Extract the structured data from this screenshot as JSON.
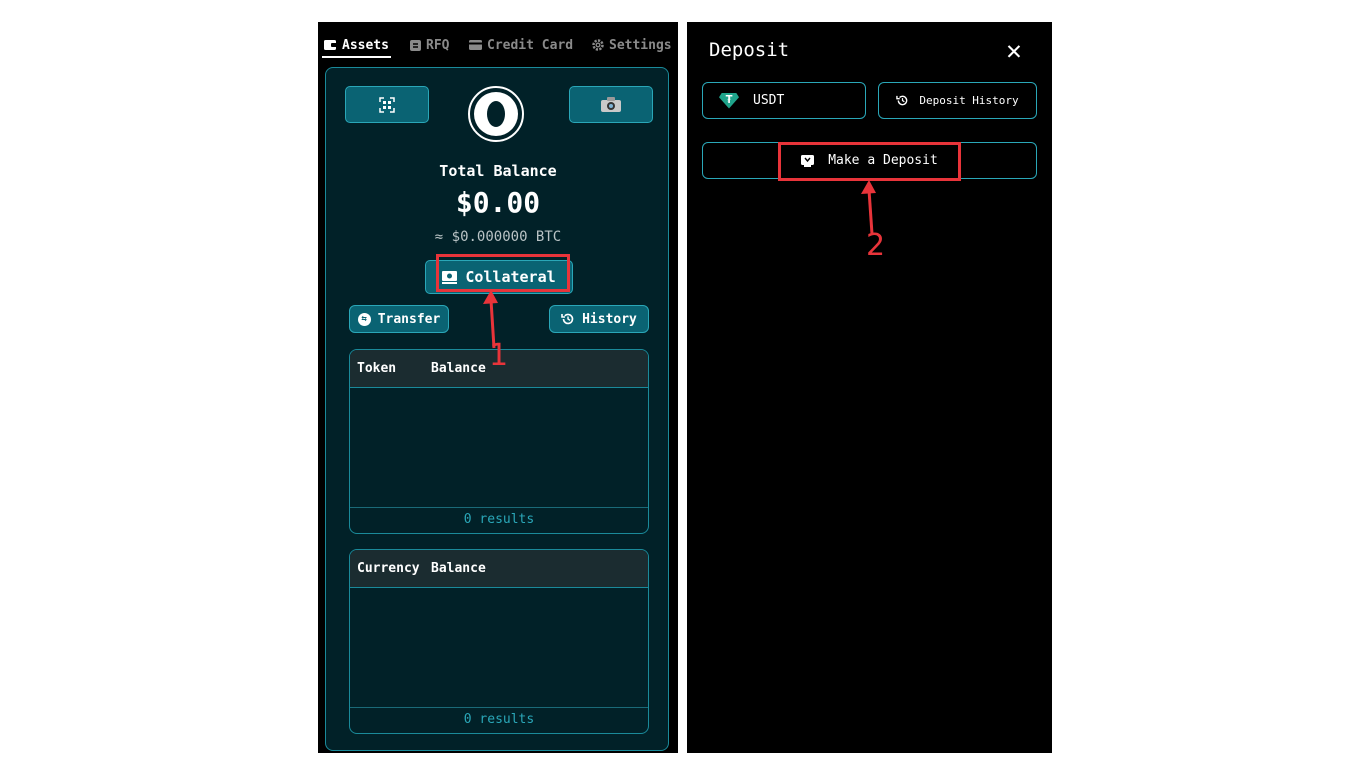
{
  "left_panel": {
    "tabs": [
      {
        "label": "Assets",
        "icon": "wallet-icon"
      },
      {
        "label": "RFQ",
        "icon": "rfq-icon"
      },
      {
        "label": "Credit Card",
        "icon": "credit-card-icon"
      },
      {
        "label": "Settings",
        "icon": "gear-icon"
      }
    ],
    "scan_icon": "qr-scan-icon",
    "camera_icon": "camera-icon",
    "total_label": "Total Balance",
    "total_value": "$0.00",
    "btc_value": "≈ $0.000000 BTC",
    "collateral_label": "Collateral",
    "transfer_label": "Transfer",
    "history_label": "History",
    "token_table": {
      "col1": "Token",
      "col2": "Balance",
      "footer": "0 results"
    },
    "currency_table": {
      "col1": "Currency",
      "col2": "Balance",
      "footer": "0 results"
    }
  },
  "right_panel": {
    "title": "Deposit",
    "close_glyph": "✕",
    "token_select": "USDT",
    "deposit_history_label": "Deposit History",
    "make_deposit_label": "Make a Deposit"
  },
  "annotations": {
    "step1": "1",
    "step2": "2"
  },
  "colors": {
    "accent": "#0a6373",
    "border": "#2aa7b8",
    "highlight": "#e8343a",
    "card_bg": "#012128"
  }
}
